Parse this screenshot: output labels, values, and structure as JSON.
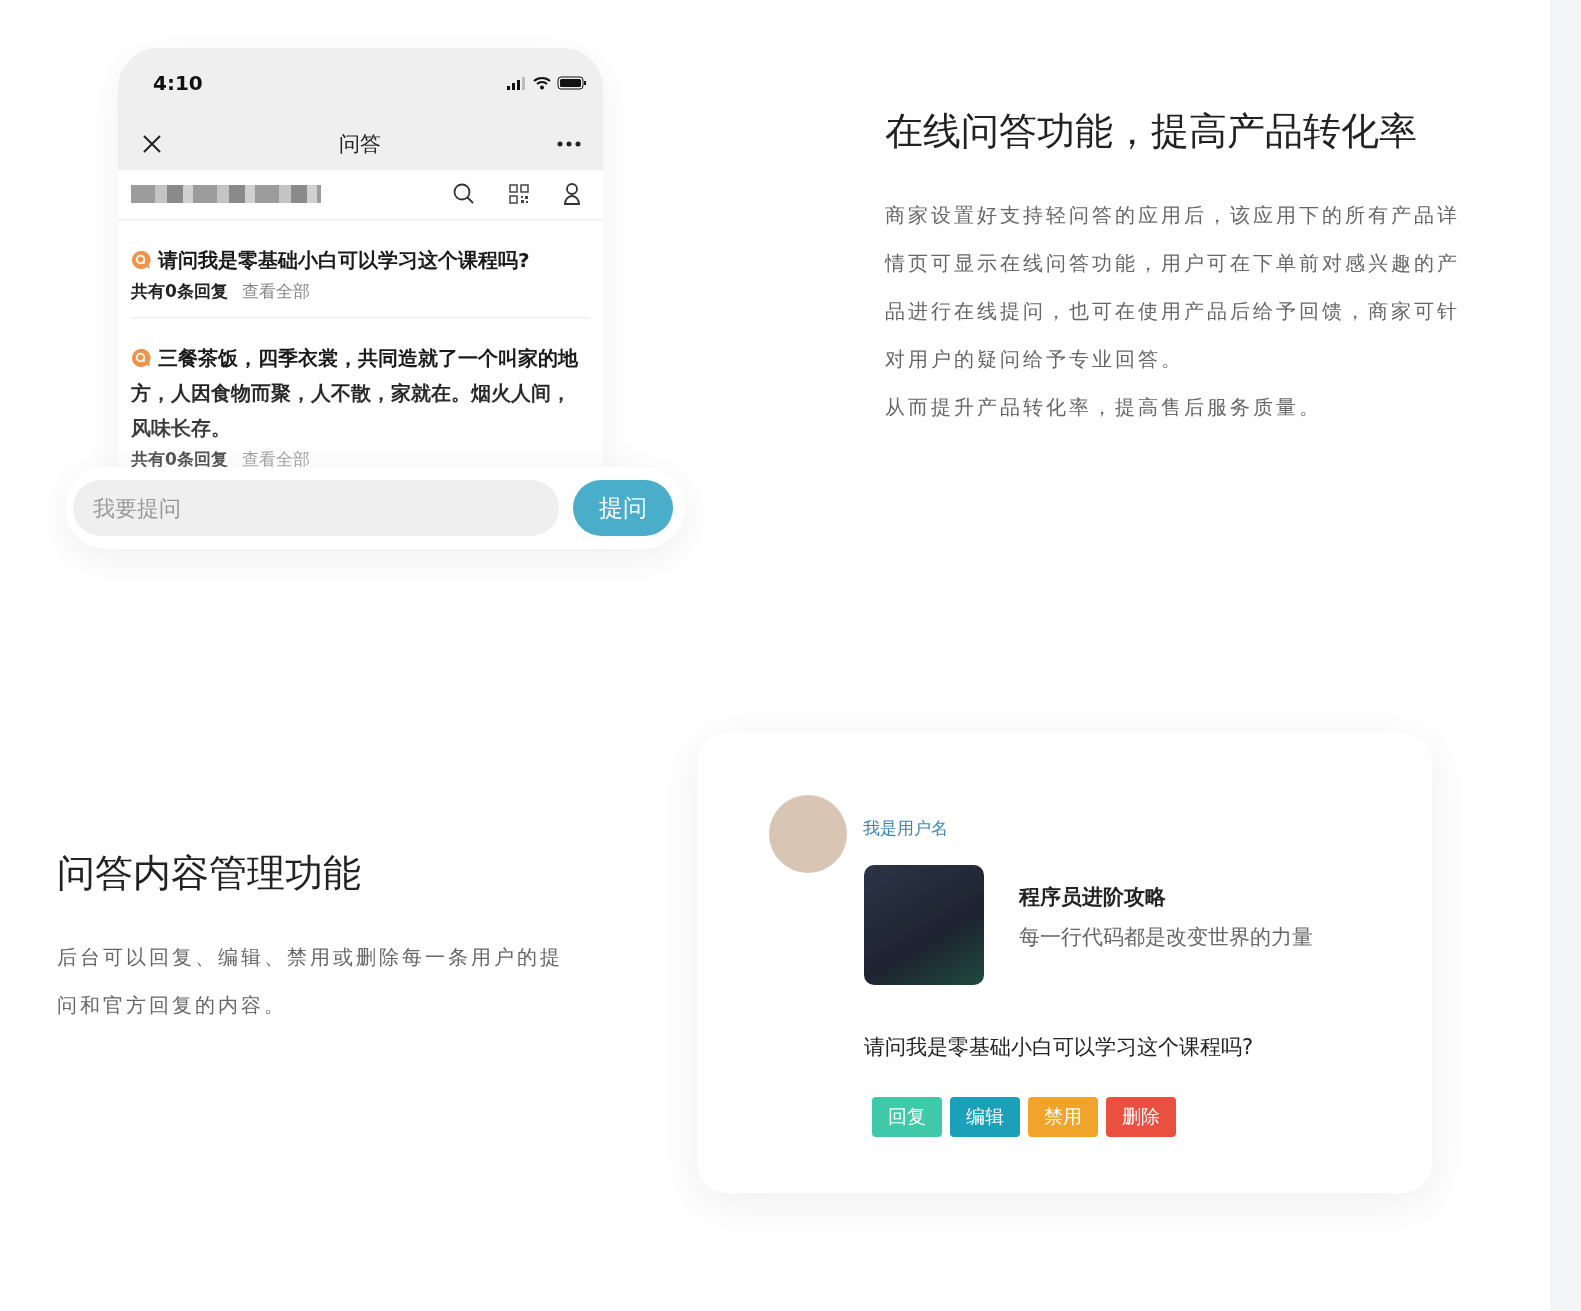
{
  "feature_qa": {
    "title": "在线问答功能，提高产品转化率",
    "paragraphs": [
      "商家设置好支持轻问答的应用后，该应用下的所有产品详情页可显示在线问答功能，用户可在下单前对感兴趣的产品进行在线提问，也可在使用产品后给予回馈，商家可针对用户的疑问给予专业回答。",
      "从而提升产品转化率，提高售后服务质量。"
    ]
  },
  "phone": {
    "time": "4:10",
    "nav_title": "问答",
    "questions": [
      {
        "text": "请问我是零基础小白可以学习这个课程吗?",
        "reply_count": "共有0条回复",
        "view_all": "查看全部"
      },
      {
        "text": "三餐茶饭，四季衣裳，共同造就了一个叫家的地方，人因食物而聚，人不散，家就在。烟火人间，风味长存。",
        "reply_count": "共有0条回复",
        "view_all": "查看全部"
      }
    ],
    "ask_input": {
      "placeholder": "我要提问"
    },
    "ask_button": "提问"
  },
  "feature_manage": {
    "title": "问答内容管理功能",
    "paragraph": "后台可以回复、编辑、禁用或删除每一条用户的提问和官方回复的内容。"
  },
  "admin_card": {
    "username": "我是用户名",
    "course_title": "程序员进阶攻略",
    "course_subtitle": "每一行代码都是改变世界的力量",
    "question": "请问我是零基础小白可以学习这个课程吗?",
    "actions": [
      {
        "label": "回复",
        "color": "#3fc9a8"
      },
      {
        "label": "编辑",
        "color": "#1aa0b9"
      },
      {
        "label": "禁用",
        "color": "#f1a42b"
      },
      {
        "label": "删除",
        "color": "#e9503f"
      }
    ]
  }
}
